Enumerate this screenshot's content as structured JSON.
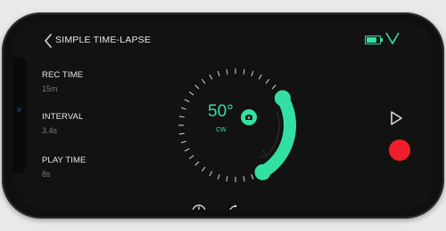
{
  "header": {
    "title": "SIMPLE TIME-LAPSE",
    "battery_level": 0.85,
    "battery_color": "#34e0a1"
  },
  "settings": [
    {
      "label": "REC TIME",
      "value": "15m"
    },
    {
      "label": "INTERVAL",
      "value": "3.4s"
    },
    {
      "label": "PLAY TIME",
      "value": "8s"
    }
  ],
  "dial": {
    "angle_label": "50°",
    "direction_label": "CW",
    "accent_color": "#34e0a1"
  },
  "controls": {
    "record_color": "#f11f2c"
  },
  "icons": {
    "back": "chevron-left-icon",
    "battery": "battery-icon",
    "status": "check-mark-icon",
    "camera": "camera-icon",
    "play": "play-icon",
    "record": "record-button",
    "clock": "clock-icon",
    "curve": "curve-icon",
    "more": "more-icon"
  }
}
